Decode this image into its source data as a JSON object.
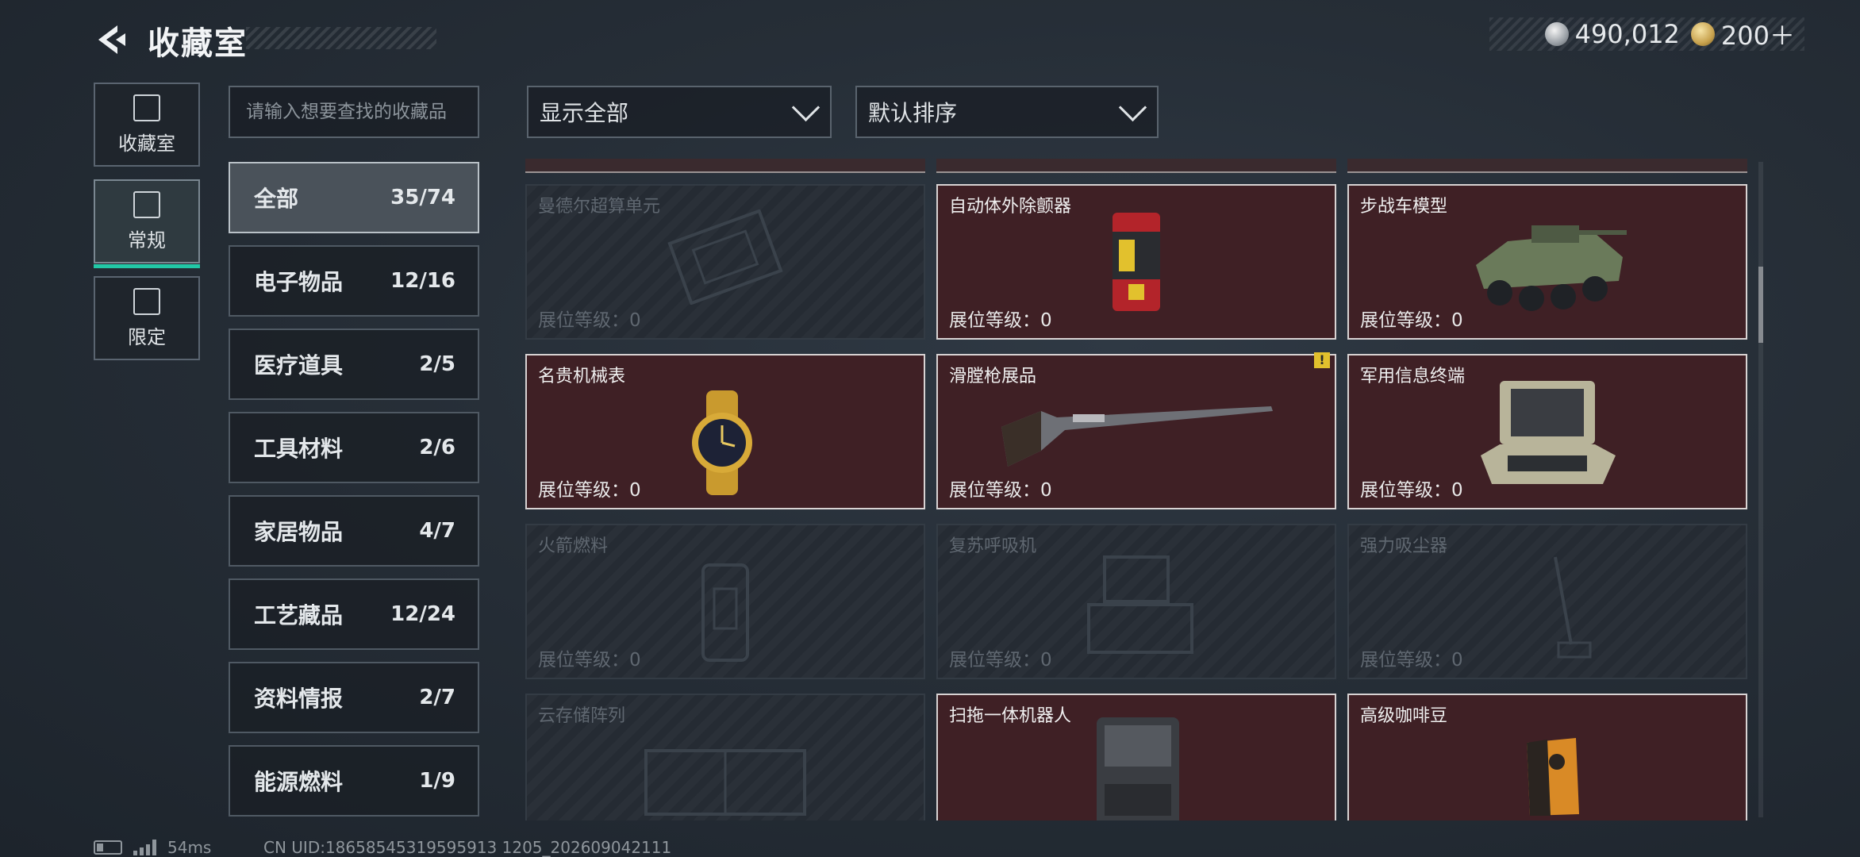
{
  "header": {
    "title": "收藏室"
  },
  "currency": {
    "silver": "490,012",
    "gold": "200＋"
  },
  "nav": [
    {
      "label": "收藏室",
      "icon": "collection-icon"
    },
    {
      "label": "常规",
      "icon": "exhibit-icon"
    },
    {
      "label": "限定",
      "icon": "limited-icon"
    }
  ],
  "search": {
    "placeholder": "请输入想要查找的收藏品"
  },
  "categories": [
    {
      "name": "全部",
      "count": "35/74"
    },
    {
      "name": "电子物品",
      "count": "12/16"
    },
    {
      "name": "医疗道具",
      "count": "2/5"
    },
    {
      "name": "工具材料",
      "count": "2/6"
    },
    {
      "name": "家居物品",
      "count": "4/7"
    },
    {
      "name": "工艺藏品",
      "count": "12/24"
    },
    {
      "name": "资料情报",
      "count": "2/7"
    },
    {
      "name": "能源燃料",
      "count": "1/9"
    }
  ],
  "filters": {
    "show": "显示全部",
    "sort": "默认排序"
  },
  "level_label": "展位等级：",
  "items": [
    {
      "name": "曼德尔超算单元",
      "level": "0",
      "owned": false
    },
    {
      "name": "自动体外除颤器",
      "level": "0",
      "owned": true
    },
    {
      "name": "步战车模型",
      "level": "0",
      "owned": true
    },
    {
      "name": "名贵机械表",
      "level": "0",
      "owned": true
    },
    {
      "name": "滑膛枪展品",
      "level": "0",
      "owned": true,
      "warning": "!"
    },
    {
      "name": "军用信息终端",
      "level": "0",
      "owned": true
    },
    {
      "name": "火箭燃料",
      "level": "0",
      "owned": false
    },
    {
      "name": "复苏呼吸机",
      "level": "0",
      "owned": false
    },
    {
      "name": "强力吸尘器",
      "level": "0",
      "owned": false
    },
    {
      "name": "云存储阵列",
      "level": "",
      "owned": false
    },
    {
      "name": "扫拖一体机器人",
      "level": "",
      "owned": true
    },
    {
      "name": "高级咖啡豆",
      "level": "",
      "owned": true
    }
  ],
  "status": {
    "ping": "54ms",
    "uid": "CN UID:18658545319595913 1205_202609042111"
  }
}
